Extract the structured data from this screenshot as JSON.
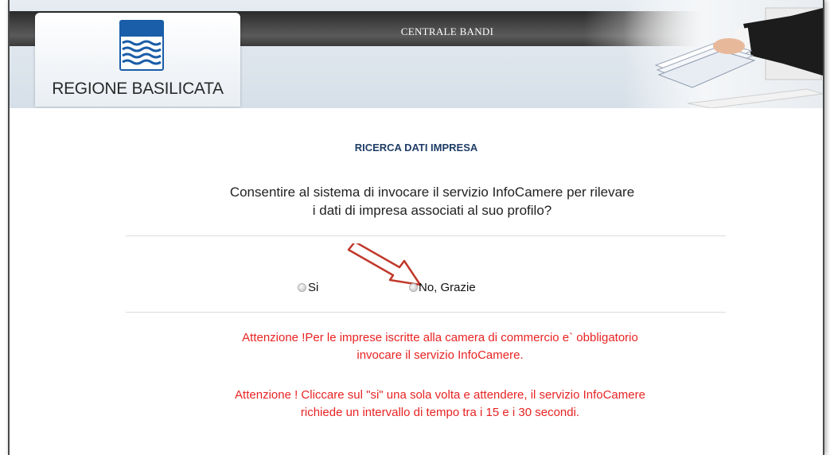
{
  "header": {
    "title": "CENTRALE BANDI",
    "logo_text": "REGIONE BASILICATA"
  },
  "main": {
    "section_title": "RICERCA DATI IMPRESA",
    "question_line1": "Consentire al sistema di invocare il servizio InfoCamere per rilevare",
    "question_line2": "i dati di impresa associati al suo profilo?",
    "option_yes": "Si",
    "option_no": "No, Grazie",
    "warning1_line1": "Attenzione !Per le imprese iscritte alla camera di commercio e` obbligatorio",
    "warning1_line2": "invocare il servizio InfoCamere.",
    "warning2_line1": "Attenzione ! Cliccare sul \"si\" una sola volta e attendere, il servizio InfoCamere",
    "warning2_line2": "richiede un intervallo di tempo tra i 15 e i 30 secondi."
  },
  "colors": {
    "title_blue": "#1f3d66",
    "warning_red": "#e82323",
    "arrow_red": "#c0392b"
  },
  "icons": {
    "logo": "regione-basilicata-shield-icon",
    "annotation": "red-outline-arrow-icon"
  }
}
